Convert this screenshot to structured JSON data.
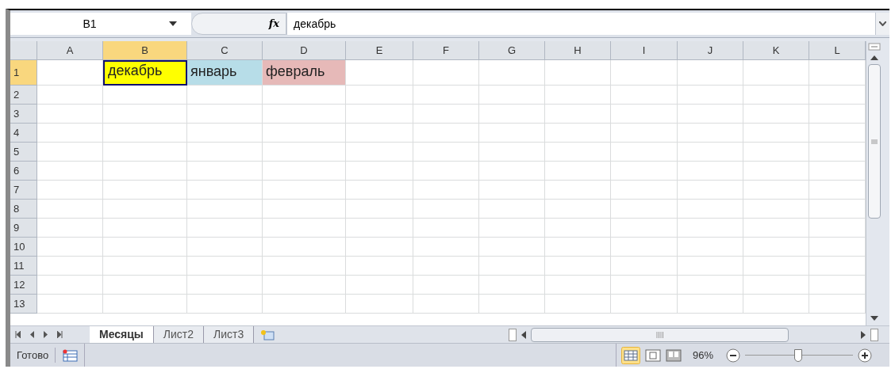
{
  "name_box": "B1",
  "formula": "декабрь",
  "formula_icon": "fx",
  "columns": [
    {
      "label": "A",
      "selected": false
    },
    {
      "label": "B",
      "selected": true
    },
    {
      "label": "C",
      "selected": false
    },
    {
      "label": "D",
      "selected": false
    },
    {
      "label": "E",
      "selected": false
    },
    {
      "label": "F",
      "selected": false
    },
    {
      "label": "G",
      "selected": false
    },
    {
      "label": "H",
      "selected": false
    },
    {
      "label": "I",
      "selected": false
    },
    {
      "label": "J",
      "selected": false
    },
    {
      "label": "K",
      "selected": false
    },
    {
      "label": "L",
      "selected": false
    }
  ],
  "rows": [
    {
      "label": "1",
      "selected": true,
      "cells": [
        {},
        {
          "text": "декабрь",
          "color": "#ffff00",
          "selected": true
        },
        {
          "text": "январь",
          "color": "#b7dde8",
          "selected": false
        },
        {
          "text": "февраль",
          "color": "#e6b9b8",
          "selected": false
        }
      ]
    },
    {
      "label": "2",
      "selected": false
    },
    {
      "label": "3",
      "selected": false
    },
    {
      "label": "4",
      "selected": false
    },
    {
      "label": "5",
      "selected": false
    },
    {
      "label": "6",
      "selected": false
    },
    {
      "label": "7",
      "selected": false
    },
    {
      "label": "8",
      "selected": false
    },
    {
      "label": "9",
      "selected": false
    },
    {
      "label": "10",
      "selected": false
    },
    {
      "label": "11",
      "selected": false
    },
    {
      "label": "12",
      "selected": false
    },
    {
      "label": "13",
      "selected": false
    }
  ],
  "sheet_tabs": [
    {
      "label": "Месяцы",
      "selected": true
    },
    {
      "label": "Лист2",
      "selected": false
    },
    {
      "label": "Лист3",
      "selected": false
    }
  ],
  "status_bar": {
    "text": "Готово",
    "zoom": "96%",
    "zoom_level": {
      "level": 0.49
    }
  }
}
